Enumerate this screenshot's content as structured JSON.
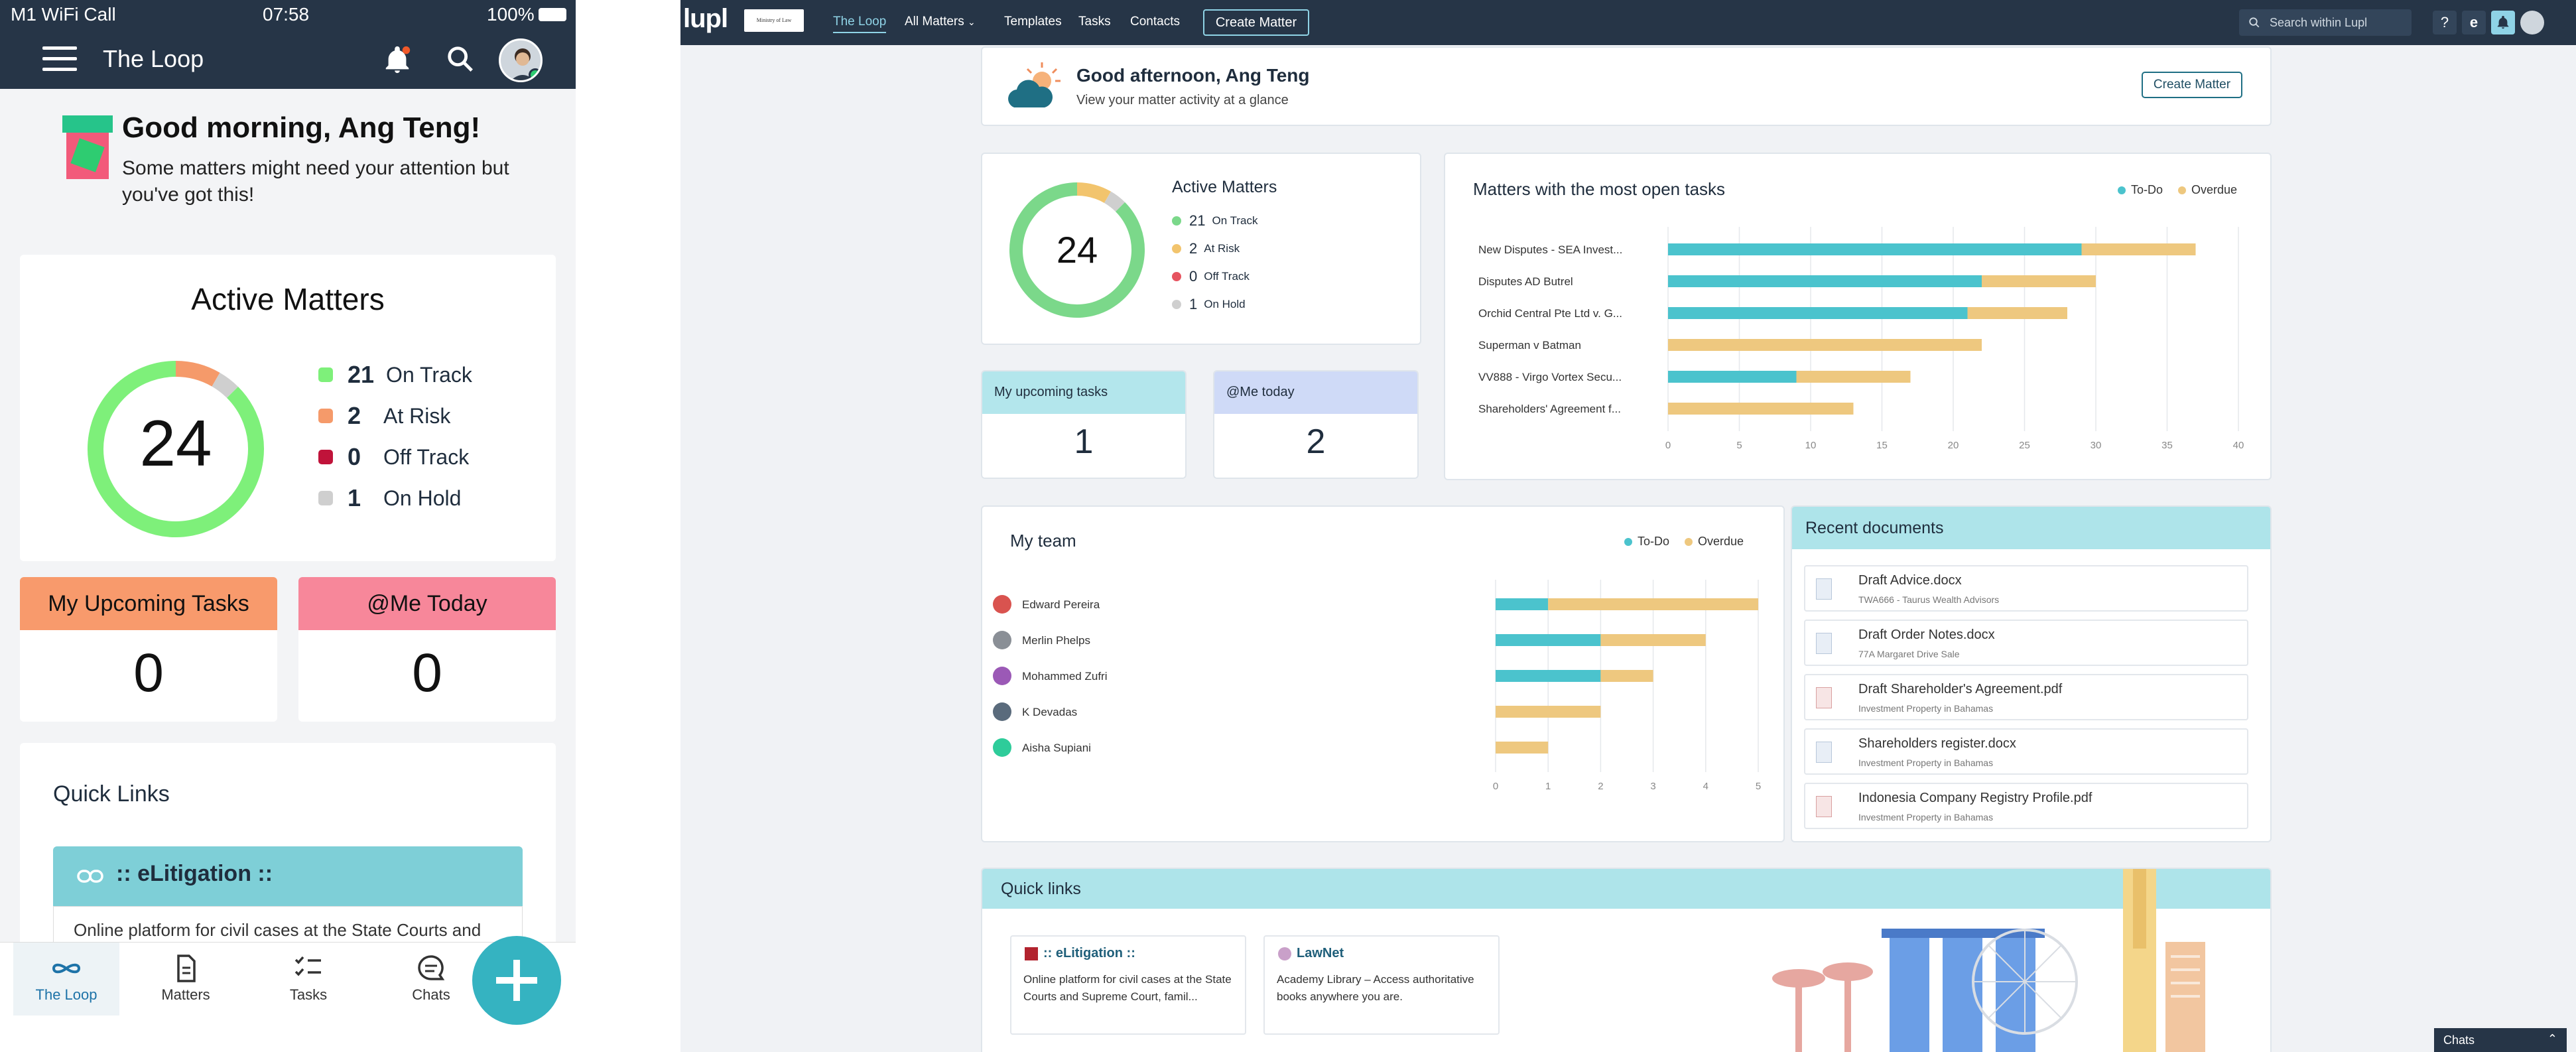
{
  "phone": {
    "status": {
      "carrier": "M1 WiFi Call",
      "time": "07:58",
      "battery": "100%"
    },
    "header": {
      "title": "The Loop"
    },
    "greeting": {
      "title": "Good morning, Ang Teng!",
      "message": "Some matters might need your attention but you've got this!"
    },
    "active_matters": {
      "title": "Active Matters",
      "total": "24",
      "items": [
        {
          "count": "21",
          "label": "On Track",
          "color": "#7ef07a"
        },
        {
          "count": "2",
          "label": "At Risk",
          "color": "#f59a6a"
        },
        {
          "count": "0",
          "label": "Off Track",
          "color": "#c0133a"
        },
        {
          "count": "1",
          "label": "On Hold",
          "color": "#cfcfcf"
        }
      ]
    },
    "upcoming_tasks": {
      "label": "My Upcoming Tasks",
      "count": "0"
    },
    "me_today": {
      "label": "@Me Today",
      "count": "0"
    },
    "quick_links": {
      "title": "Quick Links",
      "link_title": ":: eLitigation ::",
      "link_desc": "Online platform for civil cases at the State Courts and"
    },
    "nav": [
      {
        "label": "The Loop",
        "icon": "infinity-icon"
      },
      {
        "label": "Matters",
        "icon": "document-icon"
      },
      {
        "label": "Tasks",
        "icon": "checklist-icon"
      },
      {
        "label": "Chats",
        "icon": "chat-icon"
      }
    ]
  },
  "web": {
    "topbar": {
      "logo": "lupl",
      "firm": "Ministry of Law",
      "nav": [
        "The Loop",
        "All Matters",
        "Templates",
        "Tasks",
        "Contacts"
      ],
      "create_matter": "Create Matter",
      "search_placeholder": "Search within Lupl"
    },
    "greeting": {
      "title": "Good afternoon, Ang Teng",
      "subtitle": "View your matter activity at a glance",
      "create_matter": "Create Matter"
    },
    "active_matters": {
      "title": "Active Matters",
      "total": "24",
      "items": [
        {
          "count": "21",
          "label": "On Track",
          "color": "#7bd88a"
        },
        {
          "count": "2",
          "label": "At Risk",
          "color": "#f2c46d"
        },
        {
          "count": "0",
          "label": "Off Track",
          "color": "#e6535f"
        },
        {
          "count": "1",
          "label": "On Hold",
          "color": "#cfcfcf"
        }
      ]
    },
    "upcoming_tasks": {
      "label": "My upcoming tasks",
      "count": "1"
    },
    "me_today": {
      "label": "@Me today",
      "count": "2"
    },
    "open_tasks_chart": {
      "title": "Matters with the most open tasks",
      "legend": [
        "To-Do",
        "Overdue"
      ]
    },
    "team_chart": {
      "title": "My team",
      "legend": [
        "To-Do",
        "Overdue"
      ]
    },
    "recent_documents": {
      "title": "Recent documents",
      "items": [
        {
          "name": "Draft Advice.docx",
          "matter": "TWA666 - Taurus Wealth Advisors",
          "type": "doc"
        },
        {
          "name": "Draft Order Notes.docx",
          "matter": "77A Margaret Drive Sale",
          "type": "doc"
        },
        {
          "name": "Draft Shareholder's Agreement.pdf",
          "matter": "Investment Property in Bahamas",
          "type": "pdf"
        },
        {
          "name": "Shareholders register.docx",
          "matter": "Investment Property in Bahamas",
          "type": "doc"
        },
        {
          "name": "Indonesia Company Registry Profile.pdf",
          "matter": "Investment Property in Bahamas",
          "type": "pdf"
        }
      ]
    },
    "quick_links": {
      "title": "Quick links",
      "items": [
        {
          "title": ":: eLitigation ::",
          "desc": "Online platform for civil cases at the State Courts and Supreme Court, famil..."
        },
        {
          "title": "LawNet",
          "desc": "Academy Library – Access authoritative books anywhere you are."
        }
      ]
    },
    "chats": {
      "label": "Chats"
    }
  },
  "chart_data": [
    {
      "type": "bar",
      "orientation": "horizontal",
      "stacked": true,
      "title": "Matters with the most open tasks",
      "categories": [
        "New Disputes - SEA Invest...",
        "Disputes AD Butrel",
        "Orchid Central Pte Ltd v. G...",
        "Superman v Batman",
        "VV888 - Virgo Vortex Secu...",
        "Shareholders' Agreement f..."
      ],
      "series": [
        {
          "name": "To-Do",
          "color": "#4bc3cd",
          "values": [
            29,
            22,
            21,
            0,
            9,
            0
          ]
        },
        {
          "name": "Overdue",
          "color": "#eec87f",
          "values": [
            8,
            8,
            7,
            22,
            8,
            13
          ]
        }
      ],
      "xlim": [
        0,
        40
      ],
      "xticks": [
        "0",
        "5",
        "10",
        "15",
        "20",
        "25",
        "30",
        "35",
        "40"
      ],
      "grid": true,
      "legend": "top-right"
    },
    {
      "type": "bar",
      "orientation": "horizontal",
      "stacked": true,
      "title": "My team",
      "categories": [
        "Edward Pereira",
        "Merlin Phelps",
        "Mohammed Zufri",
        "K Devadas",
        "Aisha Supiani"
      ],
      "series": [
        {
          "name": "To-Do",
          "color": "#4bc3cd",
          "values": [
            1,
            2,
            2,
            0,
            0
          ]
        },
        {
          "name": "Overdue",
          "color": "#eec87f",
          "values": [
            4,
            2,
            1,
            2,
            1
          ]
        }
      ],
      "xlim": [
        0,
        5
      ],
      "xticks": [
        "0",
        "1",
        "2",
        "3",
        "4",
        "5"
      ],
      "grid": true,
      "legend": "top-right"
    }
  ]
}
